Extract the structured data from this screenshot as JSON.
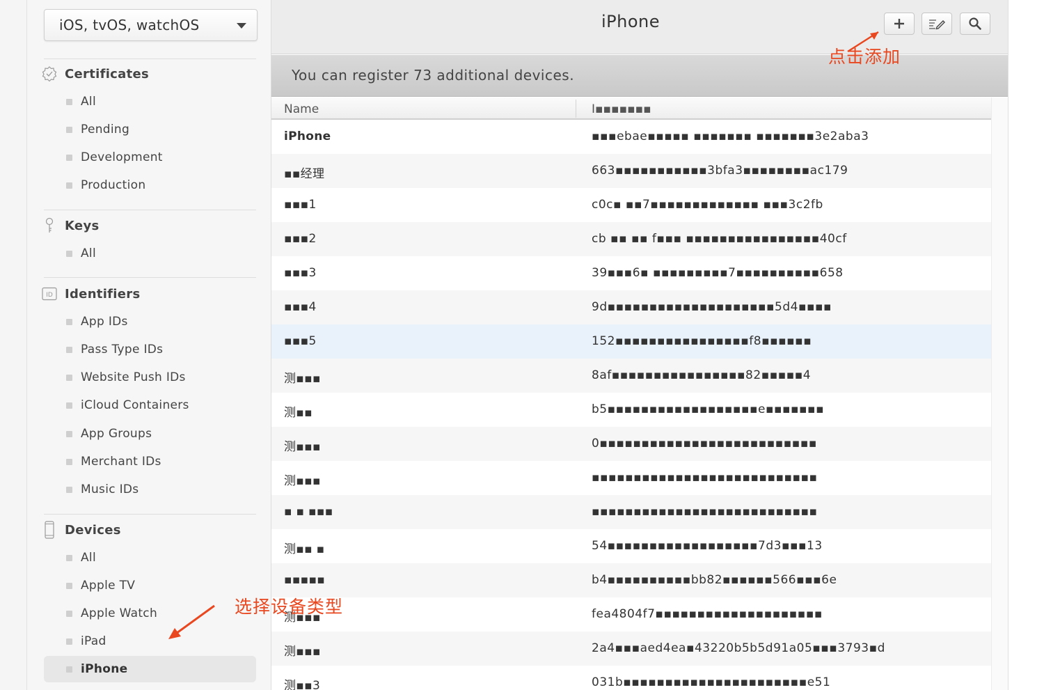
{
  "platform_select": {
    "value": "iOS, tvOS, watchOS"
  },
  "sidebar": {
    "certificates": {
      "title": "Certificates",
      "items": [
        "All",
        "Pending",
        "Development",
        "Production"
      ]
    },
    "keys": {
      "title": "Keys",
      "items": [
        "All"
      ]
    },
    "identifiers": {
      "title": "Identifiers",
      "items": [
        "App IDs",
        "Pass Type IDs",
        "Website Push IDs",
        "iCloud Containers",
        "App Groups",
        "Merchant IDs",
        "Music IDs"
      ]
    },
    "devices": {
      "title": "Devices",
      "items": [
        "All",
        "Apple TV",
        "Apple Watch",
        "iPad",
        "iPhone"
      ]
    }
  },
  "header": {
    "title": "iPhone"
  },
  "banner": {
    "text": "You can register 73 additional devices."
  },
  "table": {
    "columns": [
      "Name",
      "I▪▪▪▪▪▪▪"
    ],
    "rows": [
      {
        "name": "iPhone",
        "id": "▪▪▪ebae▪▪▪▪▪ ▪▪▪▪▪▪▪ ▪▪▪▪▪▪▪3e2aba3"
      },
      {
        "name": "▪▪经理",
        "id": "663▪▪▪▪▪▪▪▪▪▪▪3bfa3▪▪▪▪▪▪▪▪ac179"
      },
      {
        "name": "▪▪▪1",
        "id": "c0c▪ ▪▪7▪▪▪▪▪▪▪▪▪▪▪▪▪ ▪▪▪3c2fb"
      },
      {
        "name": "▪▪▪2",
        "id": "cb ▪▪ ▪▪ f▪▪▪ ▪▪▪▪▪▪▪▪▪▪▪▪▪▪▪▪40cf"
      },
      {
        "name": "▪▪▪3",
        "id": "39▪▪▪6▪ ▪▪▪▪▪▪▪▪▪7▪▪▪▪▪▪▪▪▪▪658"
      },
      {
        "name": "▪▪▪4",
        "id": "9d▪▪▪▪▪▪▪▪▪▪▪▪▪▪▪▪▪▪▪▪5d4▪▪▪▪"
      },
      {
        "name": "▪▪▪5",
        "id": "152▪▪▪▪▪▪▪▪▪▪▪▪▪▪▪▪f8▪▪▪▪▪▪"
      },
      {
        "name": "测▪▪▪",
        "id": "8af▪▪▪▪▪▪▪▪▪▪▪▪▪▪▪▪82▪▪▪▪▪4"
      },
      {
        "name": "测▪▪",
        "id": "b5▪▪▪▪▪▪▪▪▪▪▪▪▪▪▪▪▪▪e▪▪▪▪▪▪▪"
      },
      {
        "name": "测▪▪▪",
        "id": "0▪▪▪▪▪▪▪▪▪▪▪▪▪▪▪▪▪▪▪▪▪▪▪▪▪▪"
      },
      {
        "name": "测▪▪▪",
        "id": "▪▪▪▪▪▪▪▪▪▪▪▪▪▪▪▪▪▪▪▪▪▪▪▪▪▪▪"
      },
      {
        "name": "▪ ▪ ▪▪▪",
        "id": "▪▪▪▪▪▪▪▪▪▪▪▪▪▪▪▪▪▪▪▪▪▪▪▪▪▪▪"
      },
      {
        "name": "测▪▪ ▪",
        "id": "54▪▪▪▪▪▪▪▪▪▪▪▪▪▪▪▪▪▪7d3▪▪▪13"
      },
      {
        "name": "▪▪▪▪▪",
        "id": "b4▪▪▪▪▪▪▪▪▪▪bb82▪▪▪▪▪▪566▪▪▪6e"
      },
      {
        "name": "测▪▪▪",
        "id": "fea4804f7▪▪▪▪▪▪▪▪▪▪▪▪▪▪▪▪▪▪▪▪"
      },
      {
        "name": "测▪▪▪",
        "id": "2a4▪▪▪aed4ea▪43220b5b5d91a05▪▪▪3793▪d"
      },
      {
        "name": "测▪▪3",
        "id": "031b▪▪▪▪▪▪▪▪▪▪▪▪▪▪▪▪▪▪▪▪▪▪e51"
      }
    ]
  },
  "annotations": {
    "add_hint": "点击添加",
    "select_hint": "选择设备类型"
  },
  "colors": {
    "annotation": "#e8471f",
    "sidebar_bg": "#f6f6f6",
    "banner_bg": "#cfcfcf"
  },
  "icons": {
    "certificates": "badge-icon",
    "keys": "key-icon",
    "identifiers": "id-icon",
    "devices": "device-icon",
    "add": "plus-icon",
    "edit": "edit-icon",
    "search": "search-icon"
  }
}
